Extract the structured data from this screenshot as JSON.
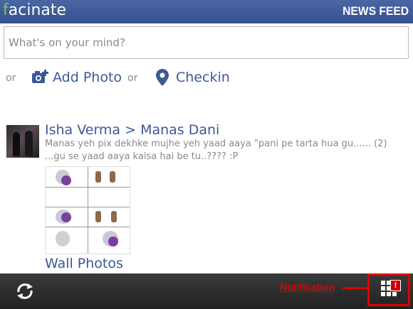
{
  "header": {
    "logo_first": "f",
    "logo_rest": "acinate",
    "title": "NEWS FEED"
  },
  "composer": {
    "placeholder": "What's on your mind?"
  },
  "actions": {
    "or_1": "or",
    "add_photo_label": "Add Photo",
    "or_2": "or",
    "checkin_label": "Checkin"
  },
  "post": {
    "author": "Isha Verma > Manas Dani",
    "message": "Manas  yeh pix dekhke mujhe yeh yaad aaya \"pani pe tarta hua gu...... (2) ...gu se yaad aaya kaisa hai be tu..???? :P",
    "album": "Wall Photos"
  },
  "bottombar": {
    "notification_label": "Notification",
    "badge_text": "!"
  },
  "icons": {
    "add_photo": "camera-plus-icon",
    "checkin": "map-pin-icon",
    "refresh": "refresh-icon",
    "notifications": "grid-icon"
  },
  "colors": {
    "header": "#3b5998",
    "link": "#3b5998",
    "logo_accent": "#8bc34a",
    "annotation": "#e00000"
  }
}
